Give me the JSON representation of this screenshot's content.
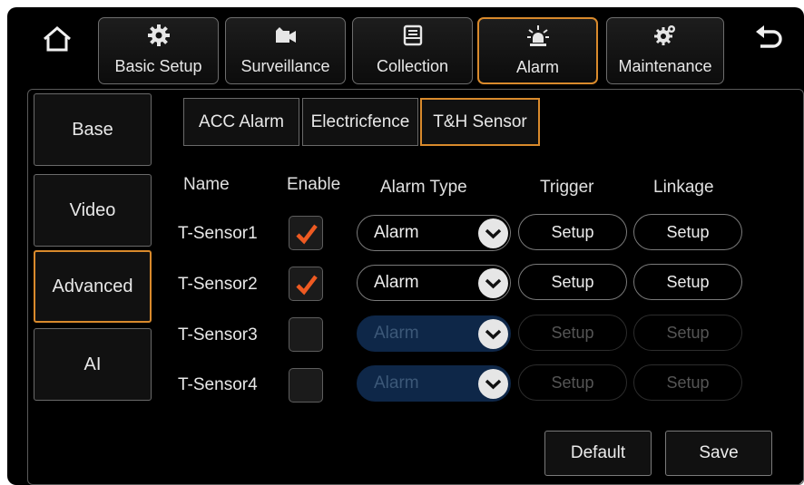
{
  "nav": {
    "tabs": [
      {
        "label": "Basic Setup",
        "icon": "gear-icon"
      },
      {
        "label": "Surveillance",
        "icon": "camera-icon"
      },
      {
        "label": "Collection",
        "icon": "collection-icon"
      },
      {
        "label": "Alarm",
        "icon": "alarm-light-icon",
        "active": true
      },
      {
        "label": "Maintenance",
        "icon": "maintenance-gears-icon"
      }
    ]
  },
  "sidebar": {
    "items": [
      {
        "label": "Base"
      },
      {
        "label": "Video"
      },
      {
        "label": "Advanced",
        "active": true
      },
      {
        "label": "AI"
      }
    ]
  },
  "subtabs": [
    {
      "label": "ACC Alarm"
    },
    {
      "label": "Electricfence"
    },
    {
      "label": "T&H Sensor",
      "active": true
    }
  ],
  "columns": {
    "name": "Name",
    "enable": "Enable",
    "alarm_type": "Alarm Type",
    "trigger": "Trigger",
    "linkage": "Linkage"
  },
  "rows": [
    {
      "name": "T-Sensor1",
      "enabled": true,
      "alarm_type": "Alarm",
      "trigger": "Setup",
      "linkage": "Setup"
    },
    {
      "name": "T-Sensor2",
      "enabled": true,
      "alarm_type": "Alarm",
      "trigger": "Setup",
      "linkage": "Setup"
    },
    {
      "name": "T-Sensor3",
      "enabled": false,
      "alarm_type": "Alarm",
      "trigger": "Setup",
      "linkage": "Setup"
    },
    {
      "name": "T-Sensor4",
      "enabled": false,
      "alarm_type": "Alarm",
      "trigger": "Setup",
      "linkage": "Setup"
    }
  ],
  "actions": {
    "default_label": "Default",
    "save_label": "Save"
  },
  "colors": {
    "accent": "#d98a2c",
    "checkmark": "#ee5a22",
    "disabled_select": "#0e2748",
    "background": "#000000"
  }
}
